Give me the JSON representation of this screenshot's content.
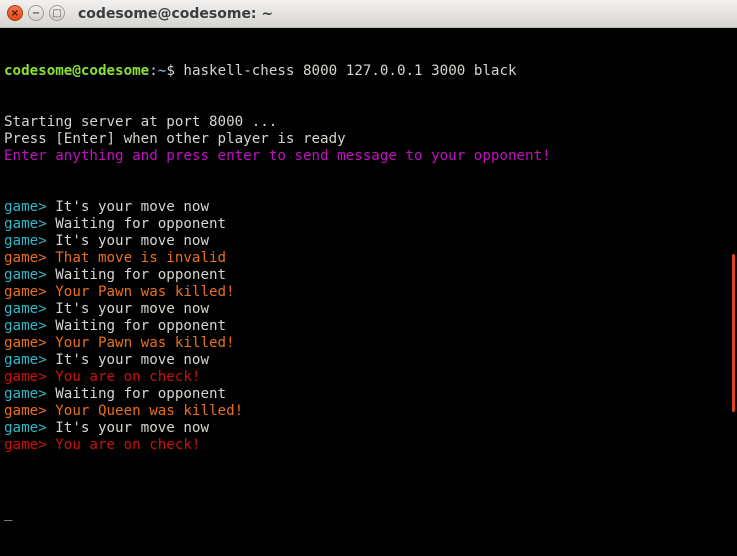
{
  "window": {
    "title": "codesome@codesome: ~",
    "close_glyph": "×",
    "minimize_glyph": "−",
    "maximize_glyph": "□"
  },
  "prompt": {
    "user_host": "codesome@codesome",
    "sep": ":",
    "path": "~",
    "symbol": "$ ",
    "command": "haskell-chess 8000 127.0.0.1 3000 black"
  },
  "output": [
    {
      "text": "Starting server at port 8000 ..."
    },
    {
      "text": "Press [Enter] when other player is ready"
    },
    {
      "text": "Enter anything and press enter to send message to your opponent!",
      "color": "#c010c0"
    }
  ],
  "game_prefix": "game> ",
  "game_lines": [
    {
      "prefix_color": "#2fb8c8",
      "text": "It's your move now",
      "color": "#d3d7cf"
    },
    {
      "prefix_color": "#2fb8c8",
      "text": "Waiting for opponent",
      "color": "#d3d7cf"
    },
    {
      "prefix_color": "#2fb8c8",
      "text": "It's your move now",
      "color": "#d3d7cf"
    },
    {
      "prefix_color": "#e8701a",
      "text": "That move is invalid",
      "color": "#e8701a"
    },
    {
      "prefix_color": "#2fb8c8",
      "text": "Waiting for opponent",
      "color": "#d3d7cf"
    },
    {
      "prefix_color": "#e8701a",
      "text": "Your Pawn was killed!",
      "color": "#e8701a"
    },
    {
      "prefix_color": "#2fb8c8",
      "text": "It's your move now",
      "color": "#d3d7cf"
    },
    {
      "prefix_color": "#2fb8c8",
      "text": "Waiting for opponent",
      "color": "#d3d7cf"
    },
    {
      "prefix_color": "#e8701a",
      "text": "Your Pawn was killed!",
      "color": "#e8701a"
    },
    {
      "prefix_color": "#2fb8c8",
      "text": "It's your move now",
      "color": "#d3d7cf"
    },
    {
      "prefix_color": "#cc1010",
      "text": "You are on check!",
      "color": "#cc1010"
    },
    {
      "prefix_color": "#2fb8c8",
      "text": "Waiting for opponent",
      "color": "#d3d7cf"
    },
    {
      "prefix_color": "#e8701a",
      "text": "Your Queen was killed!",
      "color": "#e8701a"
    },
    {
      "prefix_color": "#2fb8c8",
      "text": "It's your move now",
      "color": "#d3d7cf"
    },
    {
      "prefix_color": "#cc1010",
      "text": "You are on check!",
      "color": "#cc1010"
    }
  ],
  "cursor": "_",
  "colors": {
    "background": "#000000",
    "scrollbar": "#dd4814"
  }
}
